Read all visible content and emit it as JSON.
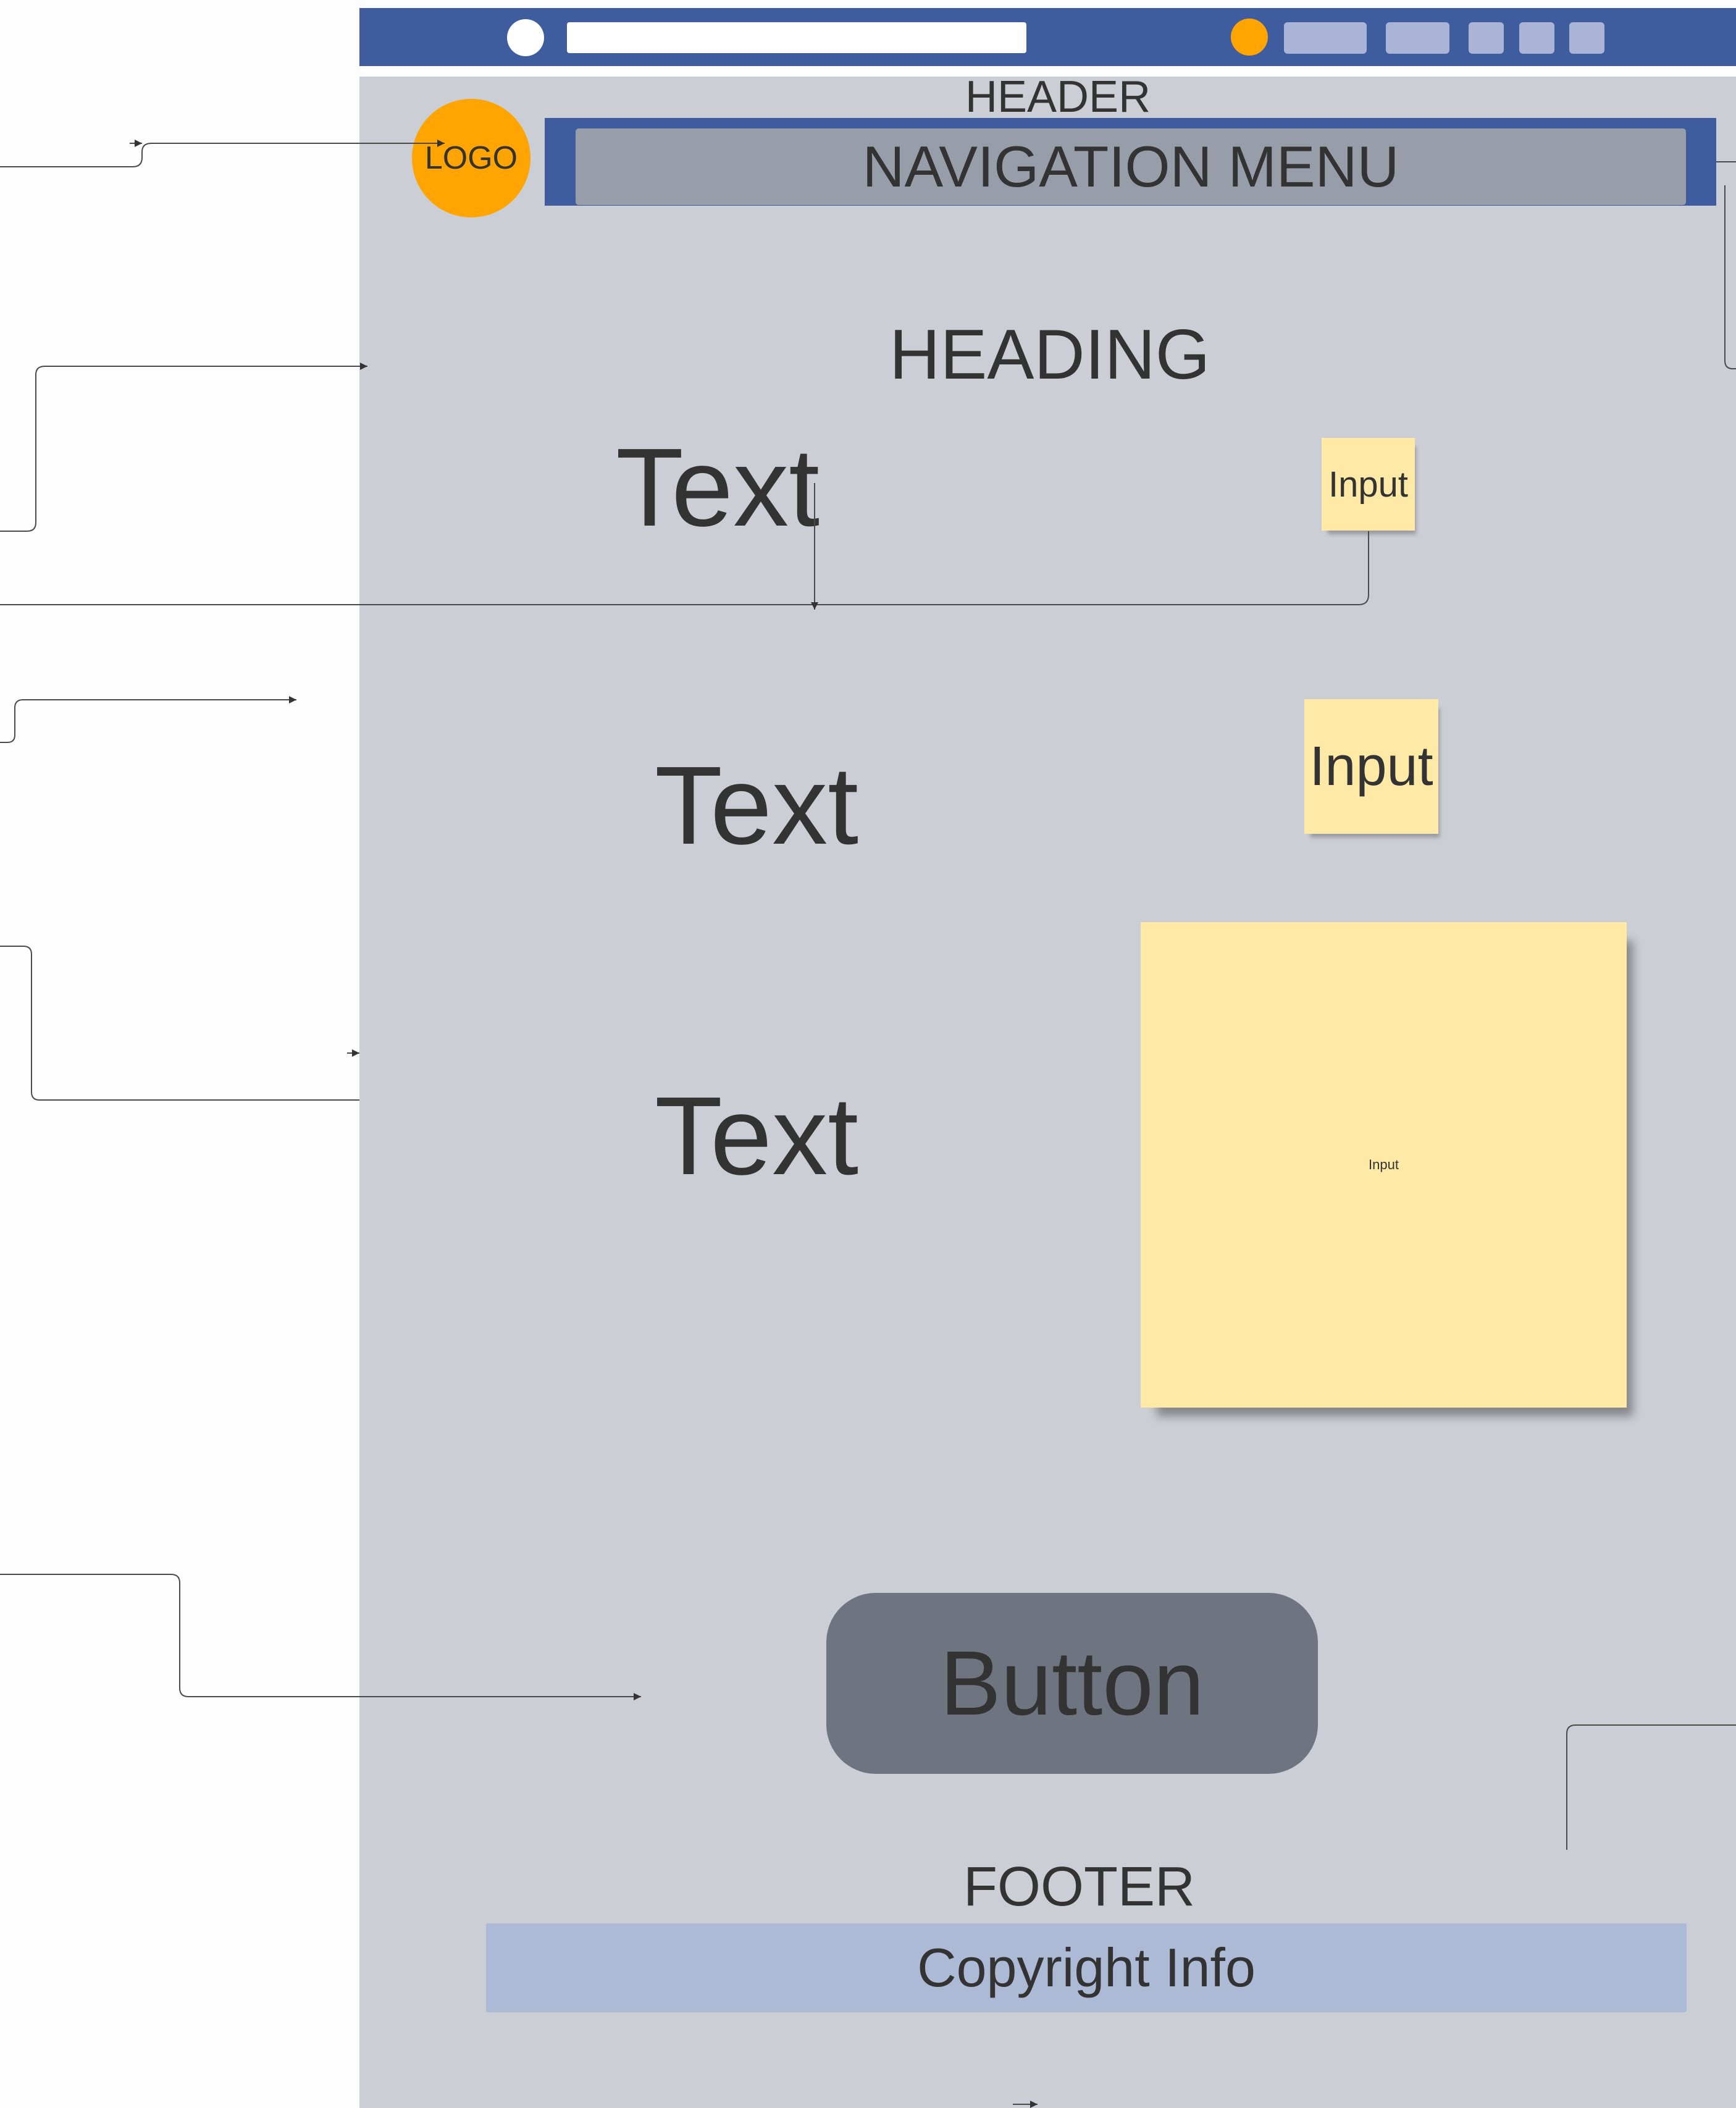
{
  "header": {
    "label": "HEADER"
  },
  "logo": {
    "label": "LOGO"
  },
  "nav": {
    "label": "NAVIGATION MENU"
  },
  "main": {
    "heading": "HEADING",
    "texts": [
      "Text",
      "Text",
      "Text"
    ],
    "inputs": [
      "Input",
      "Input",
      "Input"
    ],
    "button_label": "Button"
  },
  "footer": {
    "label": "FOOTER",
    "copyright": "Copyright Info"
  },
  "colors": {
    "browser_bar": "#3e5c9e",
    "page_background": "#cbced4",
    "logo": "#ffa400",
    "nav_inner": "#989ea9",
    "sticky_note": "#ffe9a6",
    "button": "#6e7480",
    "copyright_bar": "#adbad6"
  }
}
